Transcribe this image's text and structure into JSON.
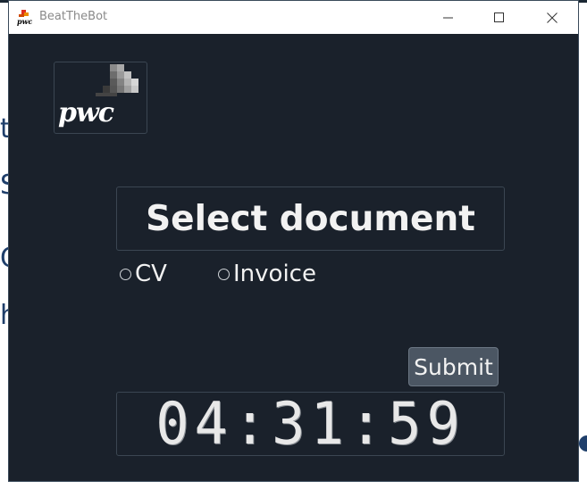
{
  "window": {
    "title": "BeatTheBot",
    "logo_text": "pwc"
  },
  "main": {
    "heading": "Select document",
    "options": [
      {
        "label": "CV",
        "selected": false
      },
      {
        "label": "Invoice",
        "selected": false
      }
    ],
    "submit_label": "Submit",
    "timer": "04:31:59"
  },
  "background": {
    "letters": [
      "t",
      "S",
      "C",
      "h"
    ]
  },
  "colors": {
    "window_bg": "#1a212b",
    "button_bg": "#4b5663",
    "text": "#f2f2f2"
  }
}
